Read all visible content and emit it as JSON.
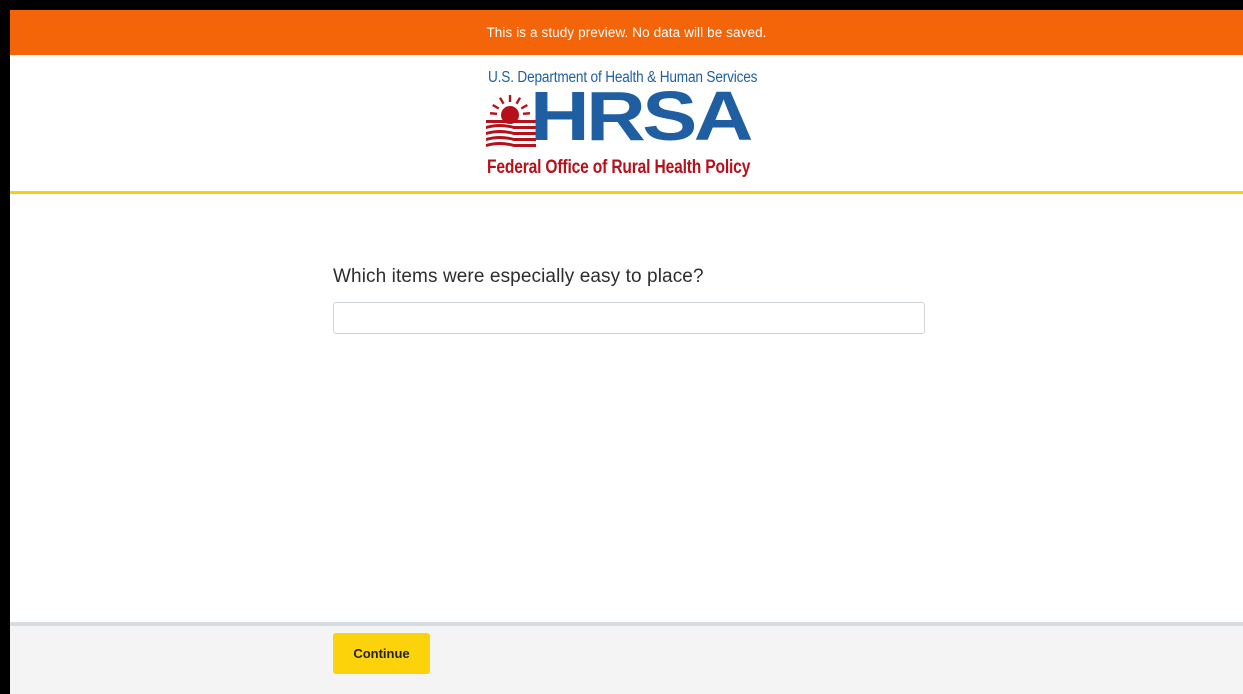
{
  "banner": {
    "text": "This is a study preview. No data will be saved."
  },
  "logo": {
    "department": "U.S. Department of Health & Human Services",
    "agency": "HRSA",
    "office": "Federal Office of Rural Health Policy",
    "colors": {
      "blue": "#1f5fa1",
      "red": "#b6111a"
    }
  },
  "question": {
    "text": "Which items were especially easy to place?",
    "answer_value": "",
    "answer_placeholder": ""
  },
  "footer": {
    "continue_label": "Continue"
  },
  "colors": {
    "banner": "#f46408",
    "accent_yellow": "#f5cf10",
    "button": "#fcd20b"
  }
}
